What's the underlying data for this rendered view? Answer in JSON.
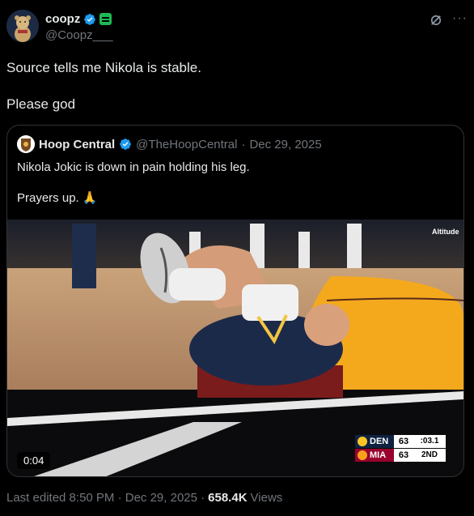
{
  "author": {
    "display_name": "coopz",
    "handle": "@Coopz___"
  },
  "tweet": {
    "lines": [
      "Source tells me Nikola is stable.",
      "Please god"
    ]
  },
  "quoted": {
    "display_name": "Hoop Central",
    "handle": "@TheHoopCentral",
    "separator": "·",
    "date": "Dec 29, 2025",
    "lines": [
      "Nikola Jokic is down in pain holding his leg.",
      "Prayers up. 🙏"
    ],
    "video": {
      "duration": "0:04",
      "scorebug": {
        "team1": "DEN",
        "score1": "63",
        "clock": ":03.1",
        "team2": "MIA",
        "score2": "63",
        "quarter": "2ND"
      },
      "broadcaster": "Altitude"
    }
  },
  "footer": {
    "edited": "Last edited 8:50 PM · Dec 29, 2025 ·",
    "views_count": "658.4K",
    "views_label": "Views"
  },
  "colors": {
    "verified": "#1d9bf0",
    "affiliate": "#1db954",
    "muted": "#71767b"
  }
}
